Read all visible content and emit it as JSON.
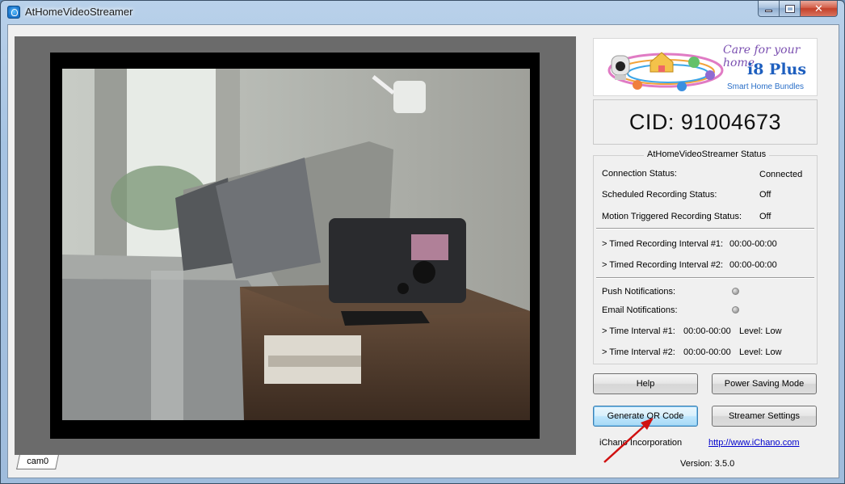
{
  "window": {
    "title": "AtHomeVideoStreamer",
    "controls": {
      "minimize": "–",
      "maximize": "□",
      "close": "✕"
    }
  },
  "video": {
    "tabs": [
      {
        "label": "cam0",
        "selected": true
      }
    ]
  },
  "logo": {
    "tagline": "Care for your home",
    "title": "i8 Plus",
    "subtitle": "Smart Home Bundles"
  },
  "cid": {
    "label": "CID:",
    "value": "91004673"
  },
  "status": {
    "title": "AtHomeVideoStreamer Status",
    "connection": {
      "label": "Connection Status:",
      "value": "Connected"
    },
    "scheduled": {
      "label": "Scheduled Recording Status:",
      "value": "Off"
    },
    "motion": {
      "label": "Motion Triggered Recording Status:",
      "value": "Off"
    },
    "timed1": {
      "label": "> Timed Recording Interval #1:",
      "value": "00:00-00:00"
    },
    "timed2": {
      "label": "> Timed Recording Interval #2:",
      "value": "00:00-00:00"
    },
    "push": {
      "label": "Push Notifications:"
    },
    "email": {
      "label": "Email Notifications:"
    },
    "time1": {
      "label": "> Time Interval #1:",
      "value": "00:00-00:00",
      "level": "Level: Low"
    },
    "time2": {
      "label": "> Time Interval #2:",
      "value": "00:00-00:00",
      "level": "Level: Low"
    }
  },
  "buttons": {
    "help": "Help",
    "power_saving": "Power Saving Mode",
    "generate_qr": "Generate QR Code",
    "streamer_settings": "Streamer Settings"
  },
  "footer": {
    "company": "iChano Incorporation",
    "url": "http://www.iChano.com",
    "version": "Version: 3.5.0"
  },
  "colors": {
    "link": "#0000cc",
    "arrow": "#d01010",
    "logo_title": "#1e5fbf"
  }
}
